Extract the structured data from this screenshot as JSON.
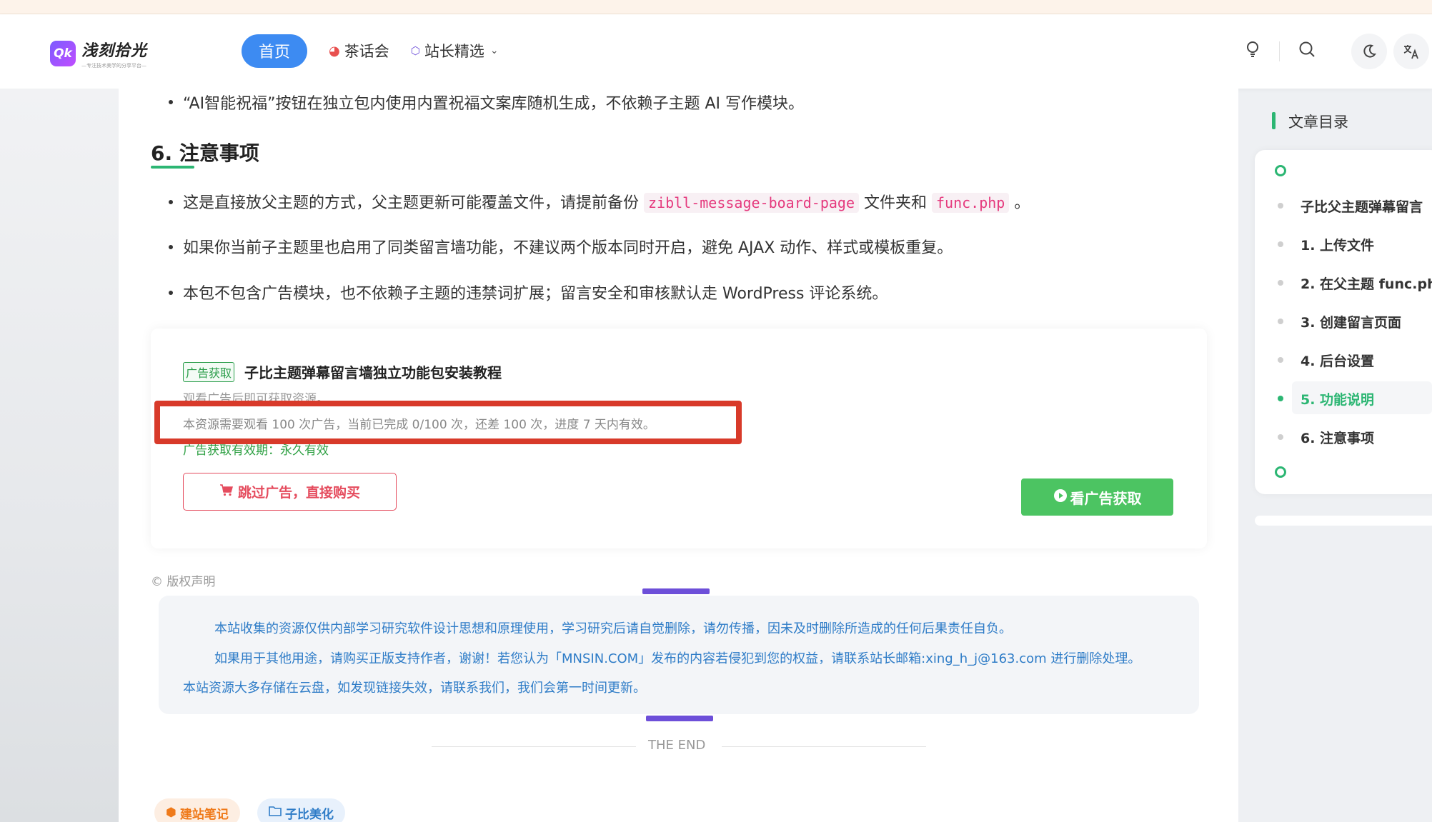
{
  "header": {
    "logo_title": "浅刻拾光",
    "logo_sub": "—专注技术美学的分享平台—",
    "nav": {
      "home": "首页",
      "tea": "茶话会",
      "picks": "站长精选"
    }
  },
  "article": {
    "top_bullet": "“AI智能祝福”按钮在独立包内使用内置祝福文案库随机生成，不依赖子主题 AI 写作模块。",
    "section_title": "6. 注意事项",
    "bullet1_pre": "这是直接放父主题的方式，父主题更新可能覆盖文件，请提前备份",
    "bullet1_code1": "zibll-message-board-page",
    "bullet1_mid": "文件夹和",
    "bullet1_code2": "func.php",
    "bullet1_post": "。",
    "bullet2": "如果你当前子主题里也启用了同类留言墙功能，不建议两个版本同时开启，避免 AJAX 动作、样式或模板重复。",
    "bullet3": "本包不包含广告模块，也不依赖子主题的违禁词扩展；留言安全和审核默认走 WordPress 评论系统。"
  },
  "ad": {
    "tag": "广告获取",
    "title": "子比主题弹幕留言墙独立功能包安装教程",
    "desc": "观看广告后即可获取资源。",
    "status": "本资源需要观看 100 次广告，当前已完成 0/100 次，还差 100 次，进度 7 天内有效。",
    "valid": "广告获取有效期：永久有效",
    "buy_label": "跳过广告，直接购买",
    "watch_label": "看广告获取"
  },
  "copyright": {
    "label": "版权声明",
    "line1": "本站收集的资源仅供内部学习研究软件设计思想和原理使用，学习研究后请自觉删除，请勿传播，因未及时删除所造成的任何后果责任自负。",
    "line2": "如果用于其他用途，请购买正版支持作者，谢谢！若您认为「MNSIN.COM」发布的内容若侵犯到您的权益，请联系站长邮箱:xing_h_j@163.com 进行删除处理。",
    "line3": "本站资源大多存储在云盘，如发现链接失效，请联系我们，我们会第一时间更新。"
  },
  "end_text": "THE END",
  "tags": [
    "建站笔记",
    "子比美化"
  ],
  "toc": {
    "title": "文章目录",
    "items": [
      "子比父主题弹幕留言",
      "1. 上传文件",
      "2. 在父主题 func.ph",
      "3. 创建留言页面",
      "4. 后台设置",
      "5. 功能说明",
      "6. 注意事项"
    ],
    "active_index": 5
  },
  "colors": {
    "accent_green": "#2cb673",
    "nav_blue": "#3d8bf2",
    "highlight_red": "#d83a2a",
    "purple": "#6d4fd9"
  }
}
